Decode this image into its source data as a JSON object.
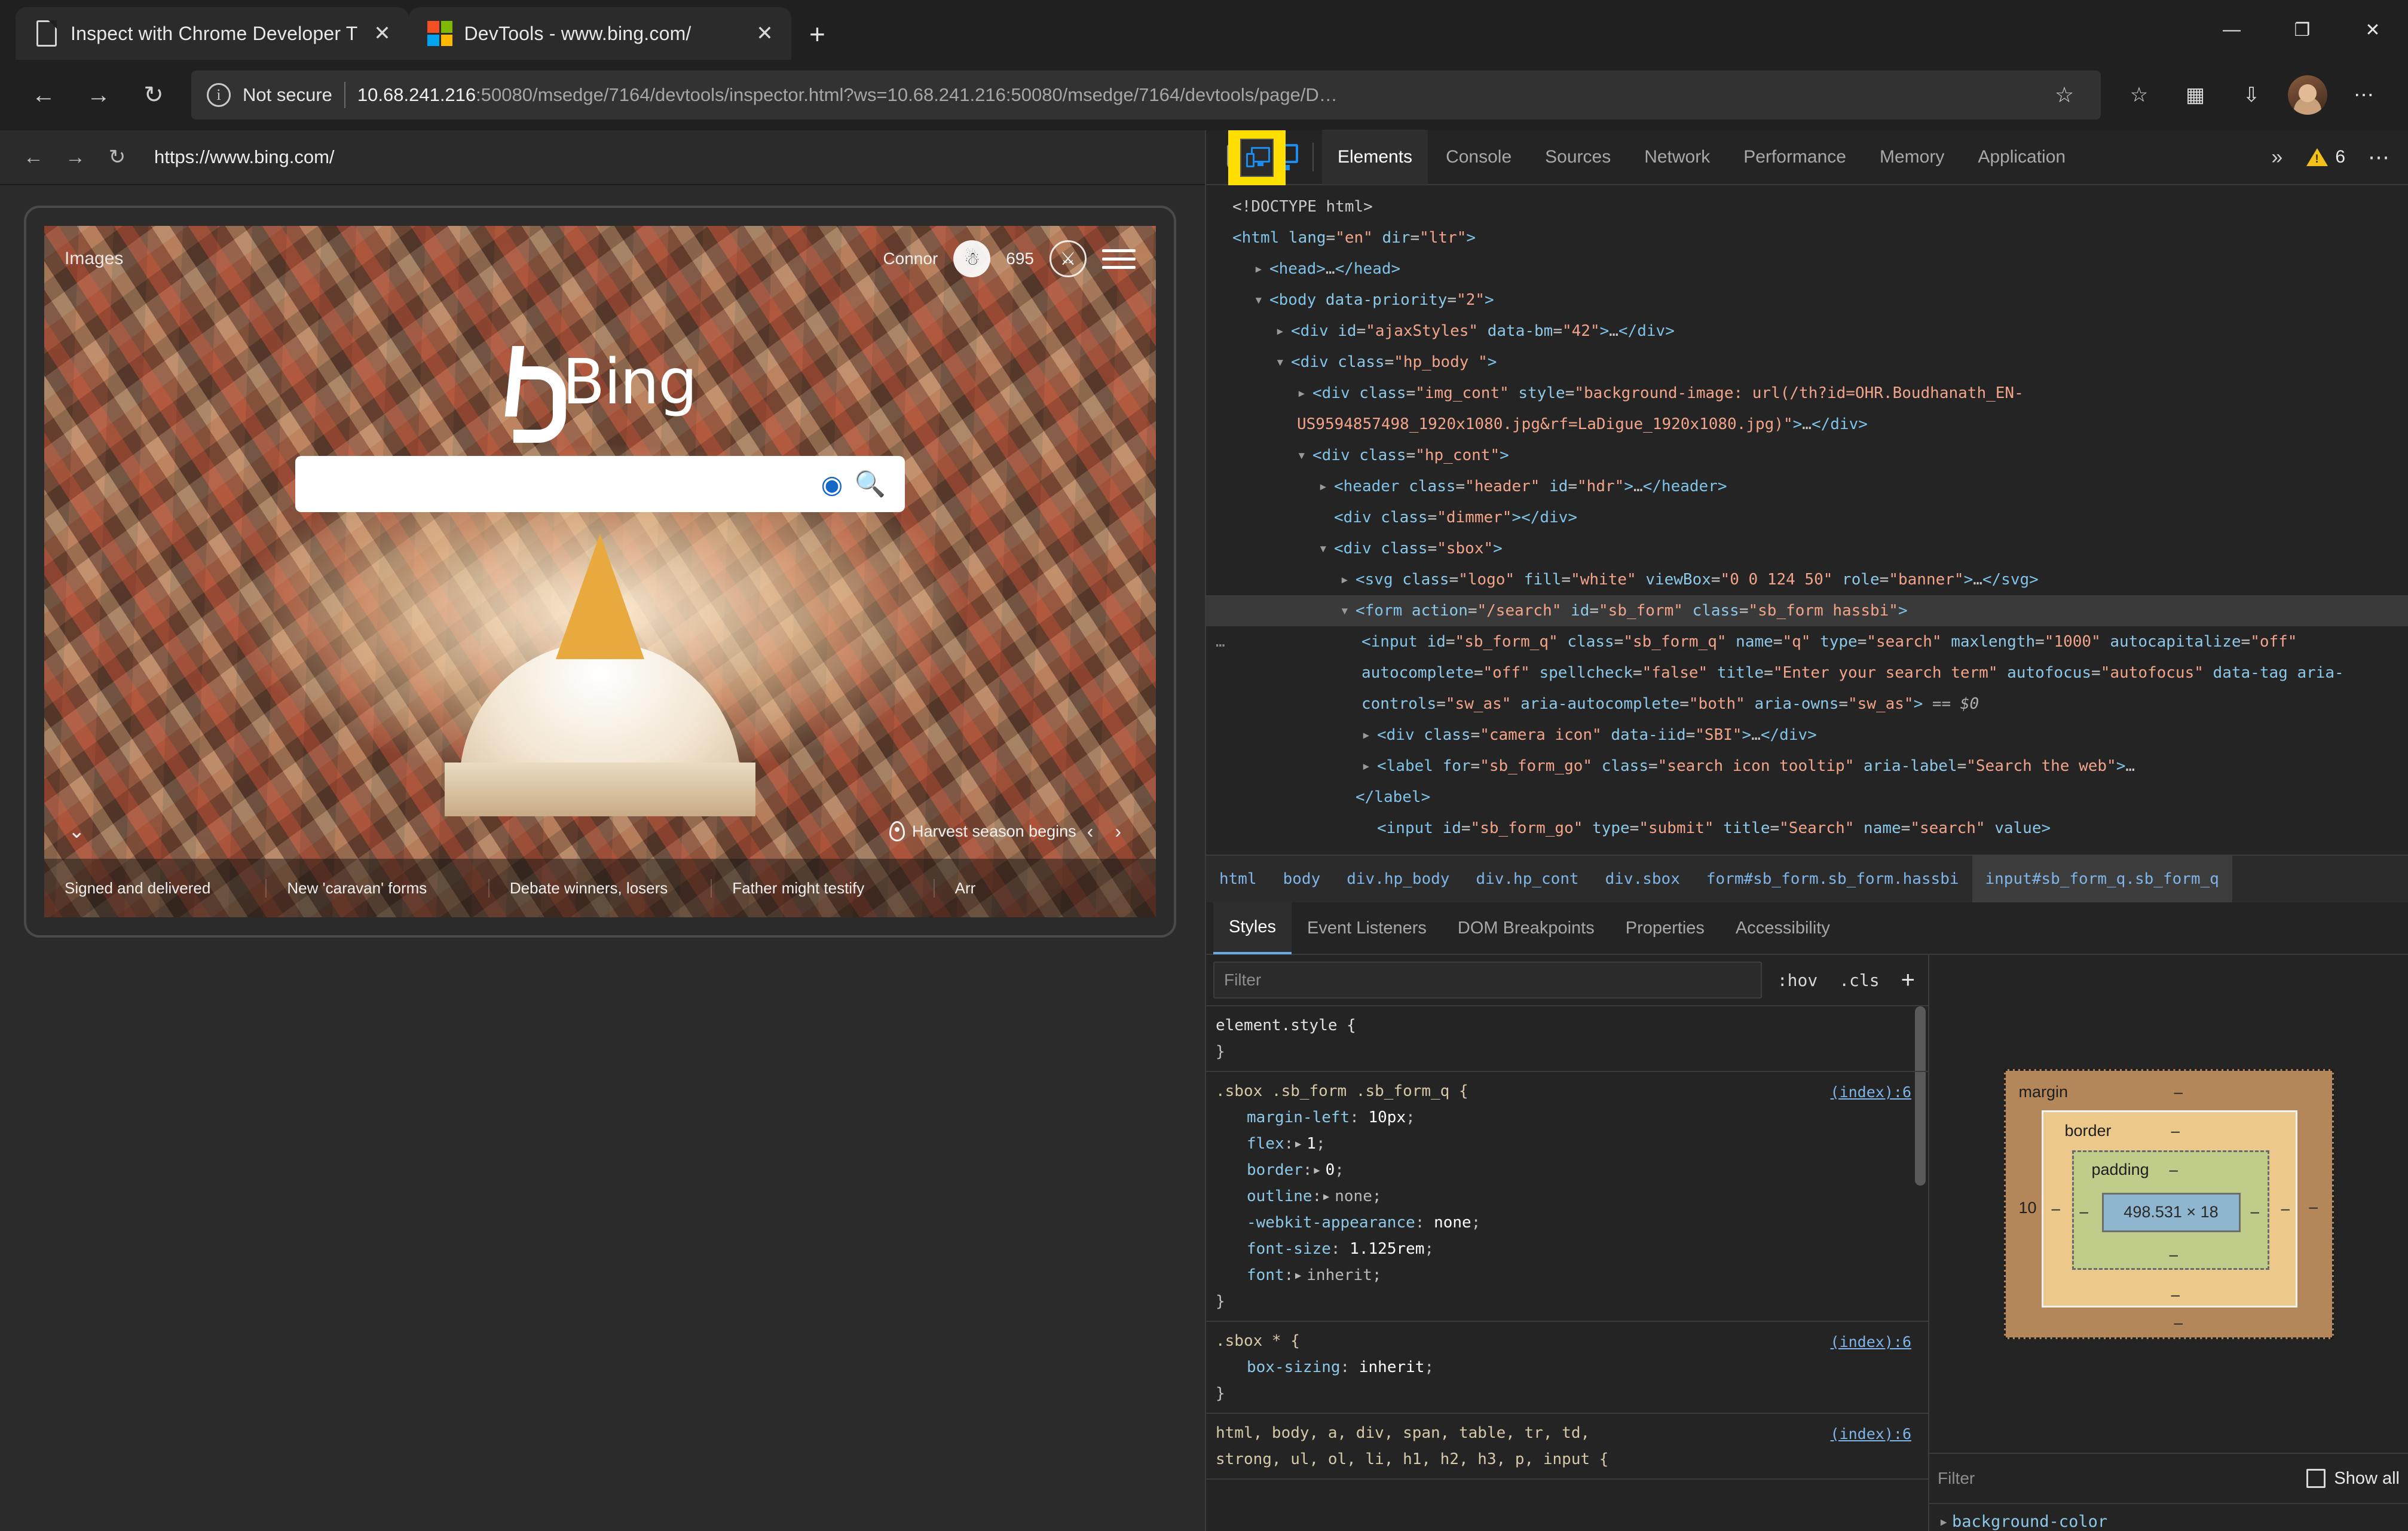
{
  "browser": {
    "tabs": [
      {
        "title": "Inspect with Chrome Developer T",
        "favicon": "document-icon",
        "close": "✕"
      },
      {
        "title": "DevTools - www.bing.com/",
        "favicon": "microsoft-icon",
        "close": "✕"
      }
    ],
    "new_tab": "+",
    "window_controls": {
      "minimize": "—",
      "maximize": "❐",
      "close": "✕"
    },
    "nav": {
      "back": "←",
      "forward": "→",
      "reload": "↻"
    },
    "omnibox": {
      "info_icon": "i",
      "security_label": "Not secure",
      "url_host": "10.68.241.216",
      "url_rest": ":50080/msedge/7164/devtools/inspector.html?ws=10.68.241.216:50080/msedge/7164/devtools/page/D…",
      "star": "☆"
    },
    "toolbar_icons": [
      "favorites-icon",
      "collections-icon",
      "browser-essentials-icon"
    ],
    "more_menu": "⋯"
  },
  "page_nav": {
    "back": "←",
    "forward": "→",
    "reload": "↻",
    "url": "https://www.bing.com/"
  },
  "bing": {
    "header": {
      "images_link": "Images",
      "user_name": "Connor",
      "rewards_points": "695",
      "account_icon": "person-icon",
      "rewards_icon": "trophy-icon",
      "menu_icon": "hamburger-icon"
    },
    "logo_text": "Bing",
    "search": {
      "value": "",
      "camera_icon": "camera-search-icon",
      "search_icon": "magnifier-icon"
    },
    "news": {
      "expand_icon": "⌄",
      "location_label": "Harvest season begins",
      "prev": "‹",
      "next": "›",
      "items": [
        "Signed and delivered",
        "New 'caravan' forms",
        "Debate winners, losers",
        "Father might testify",
        "Arr"
      ]
    }
  },
  "devtools": {
    "topbar": {
      "inspect_icon": "inspect-cursor-icon",
      "device_toolbar_icon": "device-toolbar-icon",
      "tabs": [
        "Elements",
        "Console",
        "Sources",
        "Network",
        "Performance",
        "Memory",
        "Application"
      ],
      "selected_tab": "Elements",
      "more_tabs": "»",
      "warning_count": "6",
      "more_options": "⋯",
      "highlight_color": "#ffdf00"
    },
    "dom_lines": [
      {
        "indent": 0,
        "arrow": "",
        "parts": [
          {
            "t": "tx",
            "v": "<!DOCTYPE"
          },
          {
            "t": "tx",
            "v": " html>"
          }
        ]
      },
      {
        "indent": 0,
        "arrow": "",
        "parts": [
          {
            "t": "tg",
            "v": "<html "
          },
          {
            "t": "at",
            "v": "lang"
          },
          {
            "t": "tx",
            "v": "="
          },
          {
            "t": "vl",
            "v": "\"en\""
          },
          {
            "t": "tx",
            "v": " "
          },
          {
            "t": "at",
            "v": "dir"
          },
          {
            "t": "tx",
            "v": "="
          },
          {
            "t": "vl",
            "v": "\"ltr\""
          },
          {
            "t": "tg",
            "v": ">"
          }
        ]
      },
      {
        "indent": 1,
        "arrow": "▸",
        "parts": [
          {
            "t": "tg",
            "v": "<head>"
          },
          {
            "t": "tx",
            "v": "…"
          },
          {
            "t": "tg",
            "v": "</head>"
          }
        ]
      },
      {
        "indent": 1,
        "arrow": "▾",
        "parts": [
          {
            "t": "tg",
            "v": "<body "
          },
          {
            "t": "at",
            "v": "data-priority"
          },
          {
            "t": "tx",
            "v": "="
          },
          {
            "t": "vl",
            "v": "\"2\""
          },
          {
            "t": "tg",
            "v": ">"
          }
        ]
      },
      {
        "indent": 2,
        "arrow": "▸",
        "parts": [
          {
            "t": "tg",
            "v": "<div "
          },
          {
            "t": "at",
            "v": "id"
          },
          {
            "t": "tx",
            "v": "="
          },
          {
            "t": "vl",
            "v": "\"ajaxStyles\""
          },
          {
            "t": "tx",
            "v": " "
          },
          {
            "t": "at",
            "v": "data-bm"
          },
          {
            "t": "tx",
            "v": "="
          },
          {
            "t": "vl",
            "v": "\"42\""
          },
          {
            "t": "tg",
            "v": ">"
          },
          {
            "t": "tx",
            "v": "…"
          },
          {
            "t": "tg",
            "v": "</div>"
          }
        ]
      },
      {
        "indent": 2,
        "arrow": "▾",
        "parts": [
          {
            "t": "tg",
            "v": "<div "
          },
          {
            "t": "at",
            "v": "class"
          },
          {
            "t": "tx",
            "v": "="
          },
          {
            "t": "vl",
            "v": "\"hp_body \""
          },
          {
            "t": "tg",
            "v": ">"
          }
        ]
      },
      {
        "indent": 3,
        "arrow": "▸",
        "wrap": true,
        "parts": [
          {
            "t": "tg",
            "v": "<div "
          },
          {
            "t": "at",
            "v": "class"
          },
          {
            "t": "tx",
            "v": "="
          },
          {
            "t": "vl",
            "v": "\"img_cont\""
          },
          {
            "t": "tx",
            "v": " "
          },
          {
            "t": "at",
            "v": "style"
          },
          {
            "t": "tx",
            "v": "="
          },
          {
            "t": "vl",
            "v": "\"background-image: url(/th?id=OHR.Boudhanath_EN-US9594857498_1920x1080.jpg&rf=LaDigue_1920x1080.jpg)\""
          },
          {
            "t": "tg",
            "v": ">"
          },
          {
            "t": "tx",
            "v": "…"
          },
          {
            "t": "tg",
            "v": "</div>"
          }
        ]
      },
      {
        "indent": 3,
        "arrow": "▾",
        "parts": [
          {
            "t": "tg",
            "v": "<div "
          },
          {
            "t": "at",
            "v": "class"
          },
          {
            "t": "tx",
            "v": "="
          },
          {
            "t": "vl",
            "v": "\"hp_cont\""
          },
          {
            "t": "tg",
            "v": ">"
          }
        ]
      },
      {
        "indent": 4,
        "arrow": "▸",
        "parts": [
          {
            "t": "tg",
            "v": "<header "
          },
          {
            "t": "at",
            "v": "class"
          },
          {
            "t": "tx",
            "v": "="
          },
          {
            "t": "vl",
            "v": "\"header\""
          },
          {
            "t": "tx",
            "v": " "
          },
          {
            "t": "at",
            "v": "id"
          },
          {
            "t": "tx",
            "v": "="
          },
          {
            "t": "vl",
            "v": "\"hdr\""
          },
          {
            "t": "tg",
            "v": ">"
          },
          {
            "t": "tx",
            "v": "…"
          },
          {
            "t": "tg",
            "v": "</header>"
          }
        ]
      },
      {
        "indent": 4,
        "arrow": "",
        "parts": [
          {
            "t": "tg",
            "v": "<div "
          },
          {
            "t": "at",
            "v": "class"
          },
          {
            "t": "tx",
            "v": "="
          },
          {
            "t": "vl",
            "v": "\"dimmer\""
          },
          {
            "t": "tg",
            "v": "></div>"
          }
        ]
      },
      {
        "indent": 4,
        "arrow": "▾",
        "parts": [
          {
            "t": "tg",
            "v": "<div "
          },
          {
            "t": "at",
            "v": "class"
          },
          {
            "t": "tx",
            "v": "="
          },
          {
            "t": "vl",
            "v": "\"sbox\""
          },
          {
            "t": "tg",
            "v": ">"
          }
        ]
      },
      {
        "indent": 5,
        "arrow": "▸",
        "parts": [
          {
            "t": "tg",
            "v": "<svg "
          },
          {
            "t": "at",
            "v": "class"
          },
          {
            "t": "tx",
            "v": "="
          },
          {
            "t": "vl",
            "v": "\"logo\""
          },
          {
            "t": "tx",
            "v": " "
          },
          {
            "t": "at",
            "v": "fill"
          },
          {
            "t": "tx",
            "v": "="
          },
          {
            "t": "vl",
            "v": "\"white\""
          },
          {
            "t": "tx",
            "v": " "
          },
          {
            "t": "at",
            "v": "viewBox"
          },
          {
            "t": "tx",
            "v": "="
          },
          {
            "t": "vl",
            "v": "\"0 0 124 50\""
          },
          {
            "t": "tx",
            "v": " "
          },
          {
            "t": "at",
            "v": "role"
          },
          {
            "t": "tx",
            "v": "="
          },
          {
            "t": "vl",
            "v": "\"banner\""
          },
          {
            "t": "tg",
            "v": ">"
          },
          {
            "t": "tx",
            "v": "…"
          },
          {
            "t": "tg",
            "v": "</svg>"
          }
        ]
      },
      {
        "indent": 5,
        "arrow": "▾",
        "selected_parent": true,
        "parts": [
          {
            "t": "tg",
            "v": "<form "
          },
          {
            "t": "at",
            "v": "action"
          },
          {
            "t": "tx",
            "v": "="
          },
          {
            "t": "vl",
            "v": "\"/search\""
          },
          {
            "t": "tx",
            "v": " "
          },
          {
            "t": "at",
            "v": "id"
          },
          {
            "t": "tx",
            "v": "="
          },
          {
            "t": "vl",
            "v": "\"sb_form\""
          },
          {
            "t": "tx",
            "v": " "
          },
          {
            "t": "at",
            "v": "class"
          },
          {
            "t": "tx",
            "v": "="
          },
          {
            "t": "vl",
            "v": "\"sb_form hassbi\""
          },
          {
            "t": "tg",
            "v": ">"
          }
        ]
      }
    ],
    "selected_node": {
      "ellipsis": "…",
      "text": "<input id=\"sb_form_q\" class=\"sb_form_q\" name=\"q\" type=\"search\" maxlength=\"1000\" autocapitalize=\"off\" autocomplete=\"off\" spellcheck=\"false\" title=\"Enter your search term\" autofocus=\"autofocus\" data-tag aria-controls=\"sw_as\" aria-autocomplete=\"both\" aria-owns=\"sw_as\">",
      "suffix": "== $0"
    },
    "dom_lines_after": [
      {
        "indent": 6,
        "arrow": "▸",
        "parts": [
          {
            "t": "tg",
            "v": "<div "
          },
          {
            "t": "at",
            "v": "class"
          },
          {
            "t": "tx",
            "v": "="
          },
          {
            "t": "vl",
            "v": "\"camera icon\""
          },
          {
            "t": "tx",
            "v": " "
          },
          {
            "t": "at",
            "v": "data-iid"
          },
          {
            "t": "tx",
            "v": "="
          },
          {
            "t": "vl",
            "v": "\"SBI\""
          },
          {
            "t": "tg",
            "v": ">"
          },
          {
            "t": "tx",
            "v": "…"
          },
          {
            "t": "tg",
            "v": "</div>"
          }
        ]
      },
      {
        "indent": 6,
        "arrow": "▸",
        "parts": [
          {
            "t": "tg",
            "v": "<label "
          },
          {
            "t": "at",
            "v": "for"
          },
          {
            "t": "tx",
            "v": "="
          },
          {
            "t": "vl",
            "v": "\"sb_form_go\""
          },
          {
            "t": "tx",
            "v": " "
          },
          {
            "t": "at",
            "v": "class"
          },
          {
            "t": "tx",
            "v": "="
          },
          {
            "t": "vl",
            "v": "\"search icon tooltip\""
          },
          {
            "t": "tx",
            "v": " "
          },
          {
            "t": "at",
            "v": "aria-label"
          },
          {
            "t": "tx",
            "v": "="
          },
          {
            "t": "vl",
            "v": "\"Search the web\""
          },
          {
            "t": "tg",
            "v": ">"
          },
          {
            "t": "tx",
            "v": "…"
          }
        ]
      },
      {
        "indent": 6,
        "arrow": "",
        "parts": [
          {
            "t": "tg",
            "v": "</label>"
          }
        ]
      },
      {
        "indent": 6,
        "arrow": "",
        "parts": [
          {
            "t": "tg",
            "v": "<input "
          },
          {
            "t": "at",
            "v": "id"
          },
          {
            "t": "tx",
            "v": "="
          },
          {
            "t": "vl",
            "v": "\"sb_form_go\""
          },
          {
            "t": "tx",
            "v": " "
          },
          {
            "t": "at",
            "v": "type"
          },
          {
            "t": "tx",
            "v": "="
          },
          {
            "t": "vl",
            "v": "\"submit\""
          },
          {
            "t": "tx",
            "v": " "
          },
          {
            "t": "at",
            "v": "title"
          },
          {
            "t": "tx",
            "v": "="
          },
          {
            "t": "vl",
            "v": "\"Search\""
          },
          {
            "t": "tx",
            "v": " "
          },
          {
            "t": "at",
            "v": "name"
          },
          {
            "t": "tx",
            "v": "="
          },
          {
            "t": "vl",
            "v": "\"search\""
          },
          {
            "t": "tx",
            "v": " "
          },
          {
            "t": "at",
            "v": "value"
          },
          {
            "t": "tg",
            "v": ">"
          }
        ]
      }
    ],
    "breadcrumbs": [
      {
        "label": "html",
        "active": false
      },
      {
        "label": "body",
        "active": false
      },
      {
        "label": "div.hp_body",
        "active": false
      },
      {
        "label": "div.hp_cont",
        "active": false
      },
      {
        "label": "div.sbox",
        "active": false
      },
      {
        "label": "form#sb_form.sb_form.hassbi",
        "active": false
      },
      {
        "label": "input#sb_form_q.sb_form_q",
        "active": true
      }
    ],
    "sidebar_tabs": [
      "Styles",
      "Event Listeners",
      "DOM Breakpoints",
      "Properties",
      "Accessibility"
    ],
    "sidebar_selected": "Styles",
    "styles_toolbar": {
      "filter_placeholder": "Filter",
      "hov": ":hov",
      "cls": ".cls",
      "add_rule": "+"
    },
    "css_rules": [
      {
        "selector": "element.style {",
        "source": "",
        "declarations": [],
        "close": "}"
      },
      {
        "selector": ".sbox .sb_form .sb_form_q {",
        "source": "(index):6",
        "declarations": [
          {
            "name": "margin-left",
            "value": "10px",
            "twist": false
          },
          {
            "name": "flex",
            "value": "1",
            "twist": true
          },
          {
            "name": "border",
            "value": "0",
            "twist": true
          },
          {
            "name": "outline",
            "value": "none",
            "twist": true,
            "dim": true
          },
          {
            "name": "-webkit-appearance",
            "value": "none",
            "twist": false
          },
          {
            "name": "font-size",
            "value": "1.125rem",
            "twist": false
          },
          {
            "name": "font",
            "value": "inherit",
            "twist": true,
            "dim": true
          }
        ],
        "close": "}"
      },
      {
        "selector": ".sbox * {",
        "source": "(index):6",
        "declarations": [
          {
            "name": "box-sizing",
            "value": "inherit",
            "twist": false
          }
        ],
        "close": "}"
      },
      {
        "selector": "html, body, a, div, span, table, tr, td,\nstrong, ul, ol, li, h1, h2, h3, p, input {",
        "source": "(index):6",
        "declarations": [],
        "close": ""
      }
    ],
    "box_model": {
      "margin_label": "margin",
      "border_label": "border",
      "padding_label": "padding",
      "content_size": "498.531 × 18",
      "margin_left": "10",
      "dash": "–"
    },
    "computed": {
      "filter_placeholder": "Filter",
      "show_all_label": "Show all",
      "show_all_checked": false,
      "first_property": "background-color",
      "twist": "▸"
    }
  }
}
